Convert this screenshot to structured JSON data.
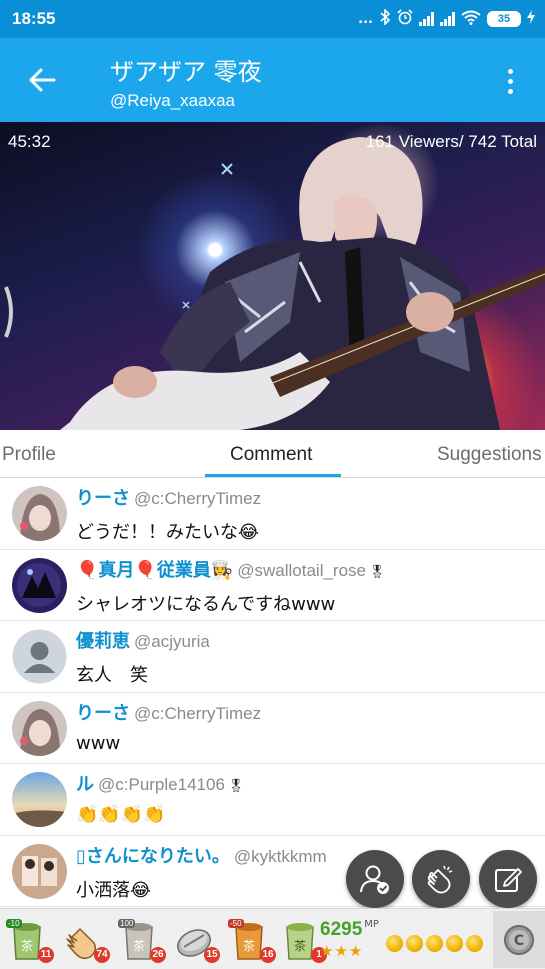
{
  "status_bar": {
    "time": "18:55",
    "dots": "...",
    "battery": "35",
    "icons": [
      "bluetooth-icon",
      "alarm-icon",
      "signal-icon",
      "signal-icon",
      "wifi-icon",
      "battery-icon",
      "charging-icon"
    ]
  },
  "header": {
    "title": "ザアザア 零夜",
    "handle": "@Reiya_xaaxaa",
    "back_icon": "back-arrow-icon",
    "menu_icon": "more-vert-icon"
  },
  "video": {
    "elapsed": "45:32",
    "viewers": "161 Viewers/ 742 Total"
  },
  "tabs": [
    {
      "label": "Profile",
      "active": false
    },
    {
      "label": "Comment",
      "active": true
    },
    {
      "label": "Suggestions",
      "active": false
    }
  ],
  "comments": [
    {
      "name": "りーさ",
      "handle": "@c:CherryTimez",
      "text": "どうだ！！みたいな😂",
      "badge": ""
    },
    {
      "name": "🎈真月🎈従業員👩‍🍳",
      "handle": "@swallotail_rose",
      "text": "シャレオツになるんですねwww",
      "badge": "🎖"
    },
    {
      "name": "優莉恵",
      "handle": "@acjyuria",
      "text": "玄人　笑",
      "badge": ""
    },
    {
      "name": "りーさ",
      "handle": "@c:CherryTimez",
      "text": "www",
      "badge": ""
    },
    {
      "name": "ル",
      "handle": "@c:Purple14106",
      "text": "👏👏👏👏",
      "badge": "🎖"
    },
    {
      "name": "▯さんになりたい。",
      "handle": "@kyktkkmm",
      "text": "小洒落😂",
      "badge": ""
    }
  ],
  "gifts": [
    {
      "icon": "tea-cup-icon",
      "label": "-10",
      "count": "11"
    },
    {
      "icon": "clap-icon",
      "label": "",
      "count": "74"
    },
    {
      "icon": "tea-cup-icon",
      "label": "100",
      "count": "26"
    },
    {
      "icon": "coin-stack-icon",
      "label": "",
      "count": "15"
    },
    {
      "icon": "tea-cup-icon",
      "label": "-50",
      "count": "16"
    },
    {
      "icon": "tea-cup-icon",
      "label": "",
      "count": "1"
    }
  ],
  "mp": {
    "value": "6295",
    "unit": "MP",
    "stars": "★★★"
  },
  "colors": {
    "status_bar": "#0a8fd6",
    "toolbar": "#1ca7ec",
    "accent": "#0e8fd0",
    "fab": "#4b4b4b"
  }
}
